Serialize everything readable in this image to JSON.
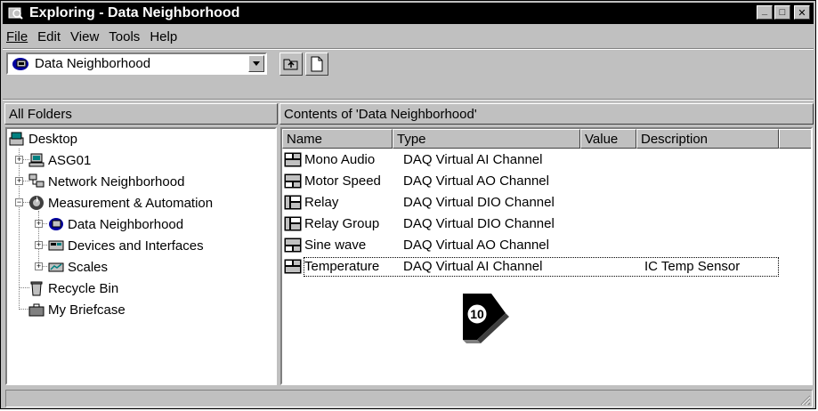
{
  "window": {
    "title": "Exploring - Data Neighborhood"
  },
  "title_buttons": {
    "minimize": "_",
    "maximize": "□",
    "close": "✕"
  },
  "menu": [
    {
      "label": "File"
    },
    {
      "label": "Edit"
    },
    {
      "label": "View"
    },
    {
      "label": "Tools"
    },
    {
      "label": "Help"
    }
  ],
  "address": {
    "value": "Data Neighborhood"
  },
  "toolbar": {
    "up_icon": "up-folder-icon",
    "new_icon": "new-document-icon"
  },
  "left_header": "All Folders",
  "right_header": "Contents of 'Data Neighborhood'",
  "tree": [
    {
      "label": "Desktop",
      "icon": "desktop-icon"
    },
    {
      "label": "ASG01",
      "icon": "computer-icon"
    },
    {
      "label": "Network Neighborhood",
      "icon": "network-icon"
    },
    {
      "label": "Measurement & Automation",
      "icon": "measurement-icon"
    },
    {
      "label": "Data Neighborhood",
      "icon": "data-neighborhood-icon"
    },
    {
      "label": "Devices and Interfaces",
      "icon": "devices-icon"
    },
    {
      "label": "Scales",
      "icon": "scales-icon"
    },
    {
      "label": "Recycle Bin",
      "icon": "recycle-bin-icon"
    },
    {
      "label": "My Briefcase",
      "icon": "briefcase-icon"
    }
  ],
  "columns": [
    "Name",
    "Type",
    "Value",
    "Description"
  ],
  "rows": [
    {
      "name": "Mono Audio",
      "type": "DAQ Virtual AI Channel",
      "value": "",
      "description": "",
      "icon": "ai-channel-icon"
    },
    {
      "name": "Motor Speed",
      "type": "DAQ Virtual AO Channel",
      "value": "",
      "description": "",
      "icon": "ao-channel-icon"
    },
    {
      "name": "Relay",
      "type": "DAQ Virtual DIO Channel",
      "value": "",
      "description": "",
      "icon": "dio-channel-icon"
    },
    {
      "name": "Relay Group",
      "type": "DAQ Virtual DIO Channel",
      "value": "",
      "description": "",
      "icon": "dio-channel-icon"
    },
    {
      "name": "Sine wave",
      "type": "DAQ Virtual AO Channel",
      "value": "",
      "description": "",
      "icon": "ao-channel-icon"
    },
    {
      "name": "Temperature",
      "type": "DAQ Virtual AI Channel",
      "value": "",
      "description": "IC Temp Sensor",
      "icon": "ai-channel-icon"
    }
  ],
  "callout": {
    "number": "10"
  },
  "status": {
    "text": ""
  }
}
